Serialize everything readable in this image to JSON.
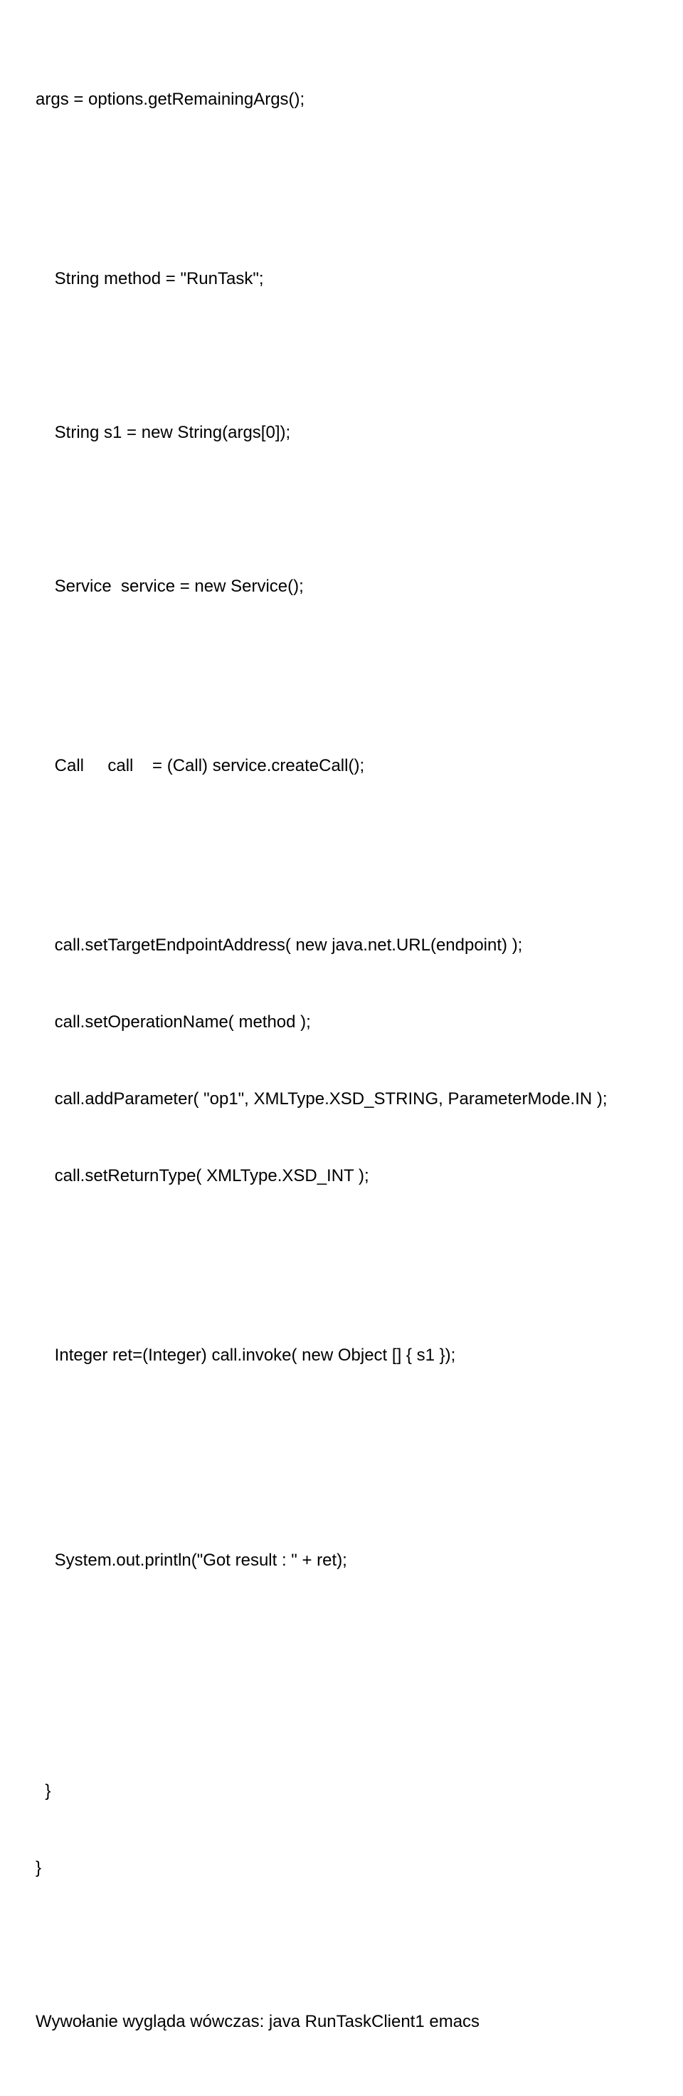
{
  "lines": {
    "l1": "args = options.getRemainingArgs();",
    "l2": "    String method = \"RunTask\";",
    "l3": "    String s1 = new String(args[0]);",
    "l4": "    Service  service = new Service();",
    "l5": "    Call     call    = (Call) service.createCall();",
    "l6": "    call.setTargetEndpointAddress( new java.net.URL(endpoint) );",
    "l7": "    call.setOperationName( method );",
    "l8": "    call.addParameter( \"op1\", XMLType.XSD_STRING, ParameterMode.IN );",
    "l9": "    call.setReturnType( XMLType.XSD_INT );",
    "l10": "    Integer ret=(Integer) call.invoke( new Object [] { s1 });",
    "l11": "    System.out.println(\"Got result : \" + ret);",
    "l12": "  }",
    "l13": "}",
    "l14": "Wywołanie wygląda wówczas: java RunTaskClient1 emacs"
  }
}
